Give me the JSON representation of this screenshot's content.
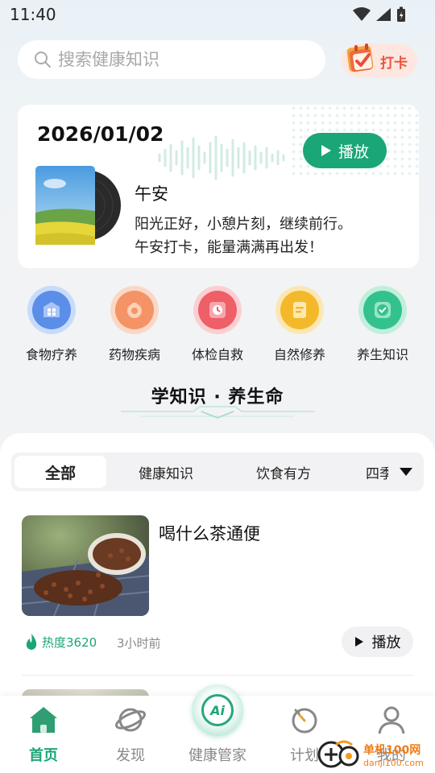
{
  "status_bar": {
    "time": "11:40"
  },
  "search": {
    "placeholder": "搜索健康知识"
  },
  "checkin": {
    "label": "打卡"
  },
  "daily_card": {
    "date": "2026/01/02",
    "play_label": "播放",
    "title": "午安",
    "lines": [
      "阳光正好，小憩片刻，继续前行。",
      "午安打卡，能量满满再出发！"
    ]
  },
  "categories": [
    {
      "label": "食物疗养",
      "color": "#5b8ee8",
      "ring": "#c9dbfb"
    },
    {
      "label": "药物疾病",
      "color": "#f39366",
      "ring": "#fbd8c6"
    },
    {
      "label": "体检自救",
      "color": "#ee5f68",
      "ring": "#fbcfd2"
    },
    {
      "label": "自然修养",
      "color": "#f3b92a",
      "ring": "#fbe7b3"
    },
    {
      "label": "养生知识",
      "color": "#33c28d",
      "ring": "#c2eedc"
    }
  ],
  "section": {
    "title": "学知识 · 养生命"
  },
  "tabs": [
    {
      "label": "全部",
      "active": true
    },
    {
      "label": "健康知识",
      "active": false
    },
    {
      "label": "饮食有方",
      "active": false
    },
    {
      "label": "四季",
      "active": false
    }
  ],
  "article": {
    "title": "喝什么茶通便",
    "heat": "热度3620",
    "time_ago": "3小时前",
    "play_label": "播放"
  },
  "nav": [
    {
      "label": "首页",
      "active": true
    },
    {
      "label": "发现",
      "active": false
    },
    {
      "label": "健康管家",
      "active": false
    },
    {
      "label": "计划",
      "active": false
    },
    {
      "label": "我的",
      "active": false
    }
  ],
  "ai_button": {
    "label": "Ai"
  },
  "watermark": {
    "line1": "单机100网",
    "line2": "danji100.com"
  },
  "colors": {
    "accent": "#1aa676",
    "checkin": "#e8553b"
  }
}
